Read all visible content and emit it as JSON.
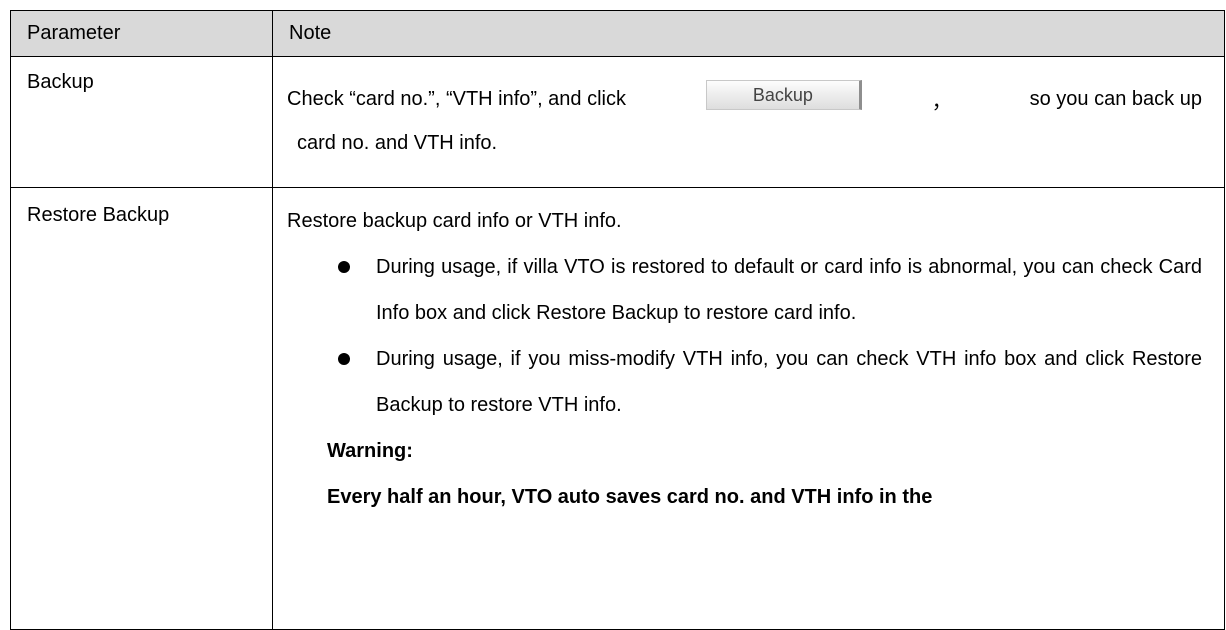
{
  "table": {
    "header": {
      "parameter": "Parameter",
      "note": "Note"
    },
    "rows": [
      {
        "parameter": "Backup",
        "note_before_button": "Check “card no.”, “VTH info”, and click",
        "button_label": "Backup",
        "comma": "，",
        "note_after_button": "so you can back up",
        "note_line2": "card no. and VTH info."
      },
      {
        "parameter": "Restore Backup",
        "intro": "Restore backup card info or VTH info.",
        "bullets": [
          "During usage, if villa VTO is restored to default or card info is abnormal, you can check Card Info box and click Restore Backup to restore card info.",
          "During usage, if you miss-modify VTH info, you can check VTH info box and click Restore Backup to restore VTH info."
        ],
        "warning_title": "Warning:",
        "warning_text": "Every half an hour, VTO auto saves card no. and VTH info in the"
      }
    ]
  }
}
